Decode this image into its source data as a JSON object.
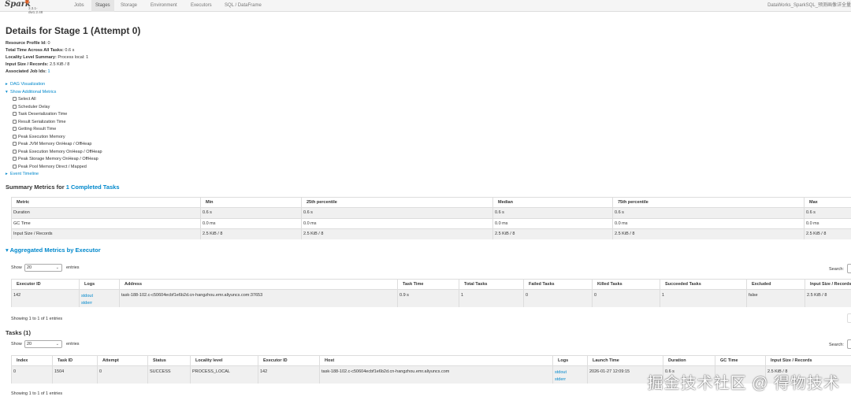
{
  "nav": {
    "brand": "Spark",
    "version": "3.3.1-dw1.2.48",
    "items": [
      "Jobs",
      "Stages",
      "Storage",
      "Environment",
      "Executors",
      "SQL / DataFrame"
    ],
    "app_title": "DataWorks_SparkSQL_预测画像详全量"
  },
  "page_title": "Details for Stage 1 (Attempt 0)",
  "summary": [
    {
      "label": "Resource Profile Id:",
      "value": "0"
    },
    {
      "label": "Total Time Across All Tasks:",
      "value": "0.6 s"
    },
    {
      "label": "Locality Level Summary:",
      "value": "Process local: 1"
    },
    {
      "label": "Input Size / Records:",
      "value": "2.5 KiB / 8"
    },
    {
      "label": "Associated Job Ids:",
      "value": "1"
    }
  ],
  "dag_visualization": "DAG Visualization",
  "show_additional_metrics": "Show Additional Metrics",
  "metric_options": [
    "Select All",
    "Scheduler Delay",
    "Task Deserialization Time",
    "Result Serialization Time",
    "Getting Result Time",
    "Peak Execution Memory",
    "Peak JVM Memory OnHeap / OffHeap",
    "Peak Execution Memory OnHeap / OffHeap",
    "Peak Storage Memory OnHeap / OffHeap",
    "Peak Pool Memory Direct / Mapped"
  ],
  "event_timeline": "Event Timeline",
  "summary_metrics": {
    "title_prefix": "Summary Metrics for ",
    "title_link": "1 Completed Tasks",
    "headers": [
      "Metric",
      "Min",
      "25th percentile",
      "Median",
      "75th percentile",
      "Max"
    ],
    "rows": [
      [
        "Duration",
        "0.6 s",
        "0.6 s",
        "0.6 s",
        "0.6 s",
        "0.6 s"
      ],
      [
        "GC Time",
        "0.0 ms",
        "0.0 ms",
        "0.0 ms",
        "0.0 ms",
        "0.0 ms"
      ],
      [
        "Input Size / Records",
        "2.5 KiB / 8",
        "2.5 KiB / 8",
        "2.5 KiB / 8",
        "2.5 KiB / 8",
        "2.5 KiB / 8"
      ]
    ]
  },
  "aggregated": {
    "title": "Aggregated Metrics by Executor",
    "show_label": "Show",
    "entries_label": "entries",
    "page_length": "20",
    "search_label": "Search:",
    "headers": [
      "Executor ID",
      "Logs",
      "Address",
      "Task Time",
      "Total Tasks",
      "Failed Tasks",
      "Killed Tasks",
      "Succeeded Tasks",
      "Excluded",
      "Input Size / Records"
    ],
    "row": {
      "executor_id": "142",
      "log_stdout": "stdout",
      "log_stderr": "stderr",
      "address": "task-188-102.c-c50604ecbf1e6b2d.cn-hangzhou.emr.aliyuncs.com:37653",
      "task_time": "0.9 s",
      "total_tasks": "1",
      "failed_tasks": "0",
      "killed_tasks": "0",
      "succeeded_tasks": "1",
      "excluded": "false",
      "input": "2.5 KiB / 8"
    },
    "info": "Showing 1 to 1 of 1 entries"
  },
  "tasks": {
    "title": "Tasks (1)",
    "show_label": "Show",
    "entries_label": "entries",
    "page_length": "20",
    "search_label": "Search:",
    "headers": [
      "Index",
      "Task ID",
      "Attempt",
      "Status",
      "Locality level",
      "Executor ID",
      "Host",
      "Logs",
      "Launch Time",
      "Duration",
      "GC Time",
      "Input Size / Records"
    ],
    "row": {
      "index": "0",
      "task_id": "1504",
      "attempt": "0",
      "status": "SUCCESS",
      "locality": "PROCESS_LOCAL",
      "executor_id": "142",
      "host": "task-188-102.c-c50604ecbf1e6b2d.cn-hangzhou.emr.aliyuncs.com",
      "log_stdout": "stdout",
      "log_stderr": "stderr",
      "launch_time": "2026-01-27 12:09:15",
      "duration": "0.6 s",
      "gc_time": "",
      "input": "2.5 KiB / 8"
    },
    "info": "Showing 1 to 1 of 1 entries"
  },
  "watermark": "掘金技术社区 @ 得物技术"
}
